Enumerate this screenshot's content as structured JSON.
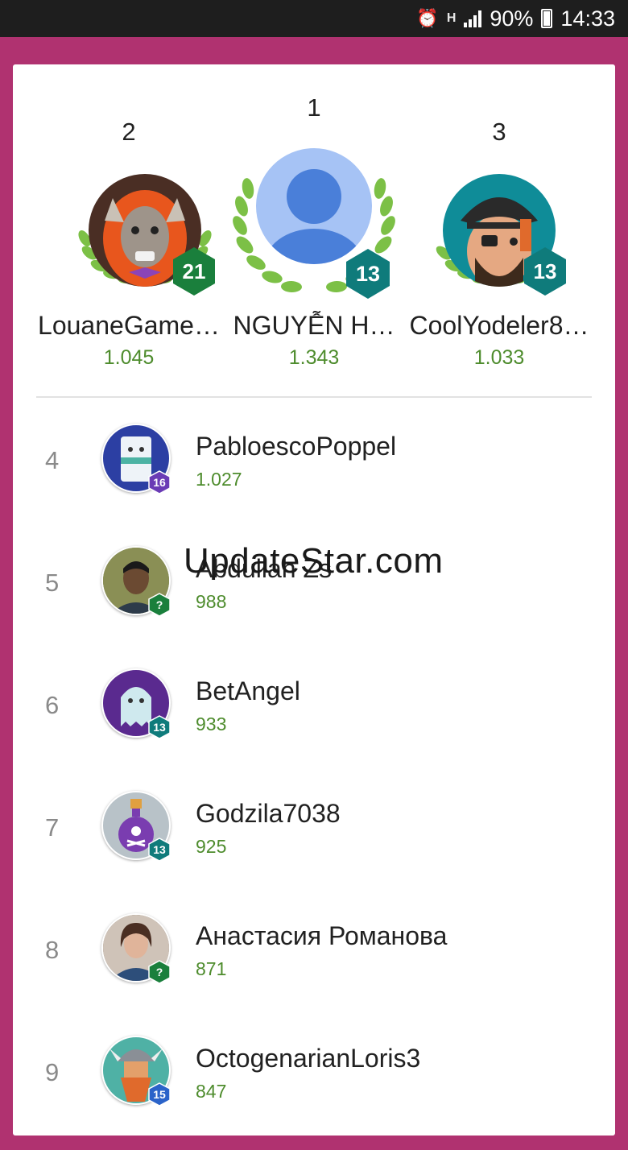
{
  "status_bar": {
    "battery": "90%",
    "time": "14:33",
    "network_type": "H",
    "icons": [
      "alarm-icon",
      "network-h-icon",
      "signal-icon",
      "battery-icon"
    ]
  },
  "podium": [
    {
      "rank": "1",
      "name": "NGUYỄN H…",
      "score": "1.343",
      "level": "13",
      "badge_color": "#0f7b7b",
      "avatar": "default-person-avatar"
    },
    {
      "rank": "2",
      "name": "LouaneGame…",
      "score": "1.045",
      "level": "21",
      "badge_color": "#1a7f3c",
      "avatar": "werewolf-avatar"
    },
    {
      "rank": "3",
      "name": "CoolYodeler8…",
      "score": "1.033",
      "level": "13",
      "badge_color": "#0f7b7b",
      "avatar": "pirate-avatar"
    }
  ],
  "leaderboard": [
    {
      "rank": "4",
      "name": "PabloescoPoppel",
      "score": "1.027",
      "level": "16",
      "badge_color": "#6a3bb5",
      "avatar": "robot-avatar"
    },
    {
      "rank": "5",
      "name": "Abdullah Zs",
      "score": "988",
      "level": "?",
      "badge_color": "#1a7f3c",
      "avatar": "photo-avatar"
    },
    {
      "rank": "6",
      "name": "BetAngel",
      "score": "933",
      "level": "13",
      "badge_color": "#0f7b7b",
      "avatar": "ghost-avatar"
    },
    {
      "rank": "7",
      "name": "Godzila7038",
      "score": "925",
      "level": "13",
      "badge_color": "#0f7b7b",
      "avatar": "potion-avatar"
    },
    {
      "rank": "8",
      "name": "Анастасия Романова",
      "score": "871",
      "level": "?",
      "badge_color": "#1a7f3c",
      "avatar": "photo-avatar"
    },
    {
      "rank": "9",
      "name": "OctogenarianLoris3",
      "score": "847",
      "level": "15",
      "badge_color": "#2b63c9",
      "avatar": "viking-avatar"
    }
  ],
  "watermark": "UpdateStar.com",
  "colors": {
    "page_background": "#b03270",
    "card_background": "#ffffff",
    "score_green": "#4e8c2d",
    "status_bar": "#1e1e1e"
  }
}
